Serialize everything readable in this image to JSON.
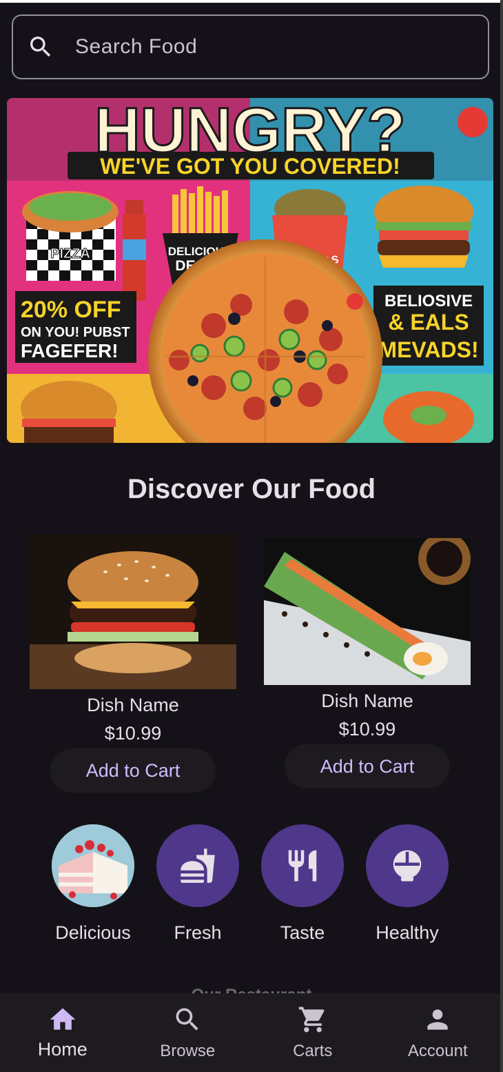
{
  "search": {
    "placeholder": "Search Food"
  },
  "banner": {
    "headline": "HUNGRY?",
    "subline": "WE'VE GOT YOU COVERED!",
    "box_label": "PIZZA",
    "fries_label_1": "DELICIOUS",
    "fries_label_2": "DEALS",
    "takeout_label": "BUG CHAS",
    "offer_1": "20% OFF",
    "offer_2": "ON YOU! PUBST",
    "offer_3": "FAGEFER!",
    "promo_1": "BELIOSIVE",
    "promo_2": "& EALS",
    "promo_3": "MEVADS!"
  },
  "section_title": "Discover Our Food",
  "cards": [
    {
      "name": "Dish Name",
      "price": "$10.99",
      "button": "Add to Cart"
    },
    {
      "name": "Dish Name",
      "price": "$10.99",
      "button": "Add to Cart"
    }
  ],
  "categories": [
    {
      "label": "Delicious",
      "icon": "cake-photo"
    },
    {
      "label": "Fresh",
      "icon": "fastfood-icon"
    },
    {
      "label": "Taste",
      "icon": "restaurant-icon"
    },
    {
      "label": "Healthy",
      "icon": "rice-bowl-icon"
    }
  ],
  "partial_heading": "Our Restaurant",
  "nav": [
    {
      "label": "Home",
      "icon": "home-icon",
      "active": true
    },
    {
      "label": "Browse",
      "icon": "search-icon"
    },
    {
      "label": "Carts",
      "icon": "cart-icon"
    },
    {
      "label": "Account",
      "icon": "account-icon"
    }
  ],
  "colors": {
    "background": "#141218",
    "accent": "#4f378b",
    "button_text": "#d0bcff",
    "nav_active": "#cdbaf5"
  }
}
